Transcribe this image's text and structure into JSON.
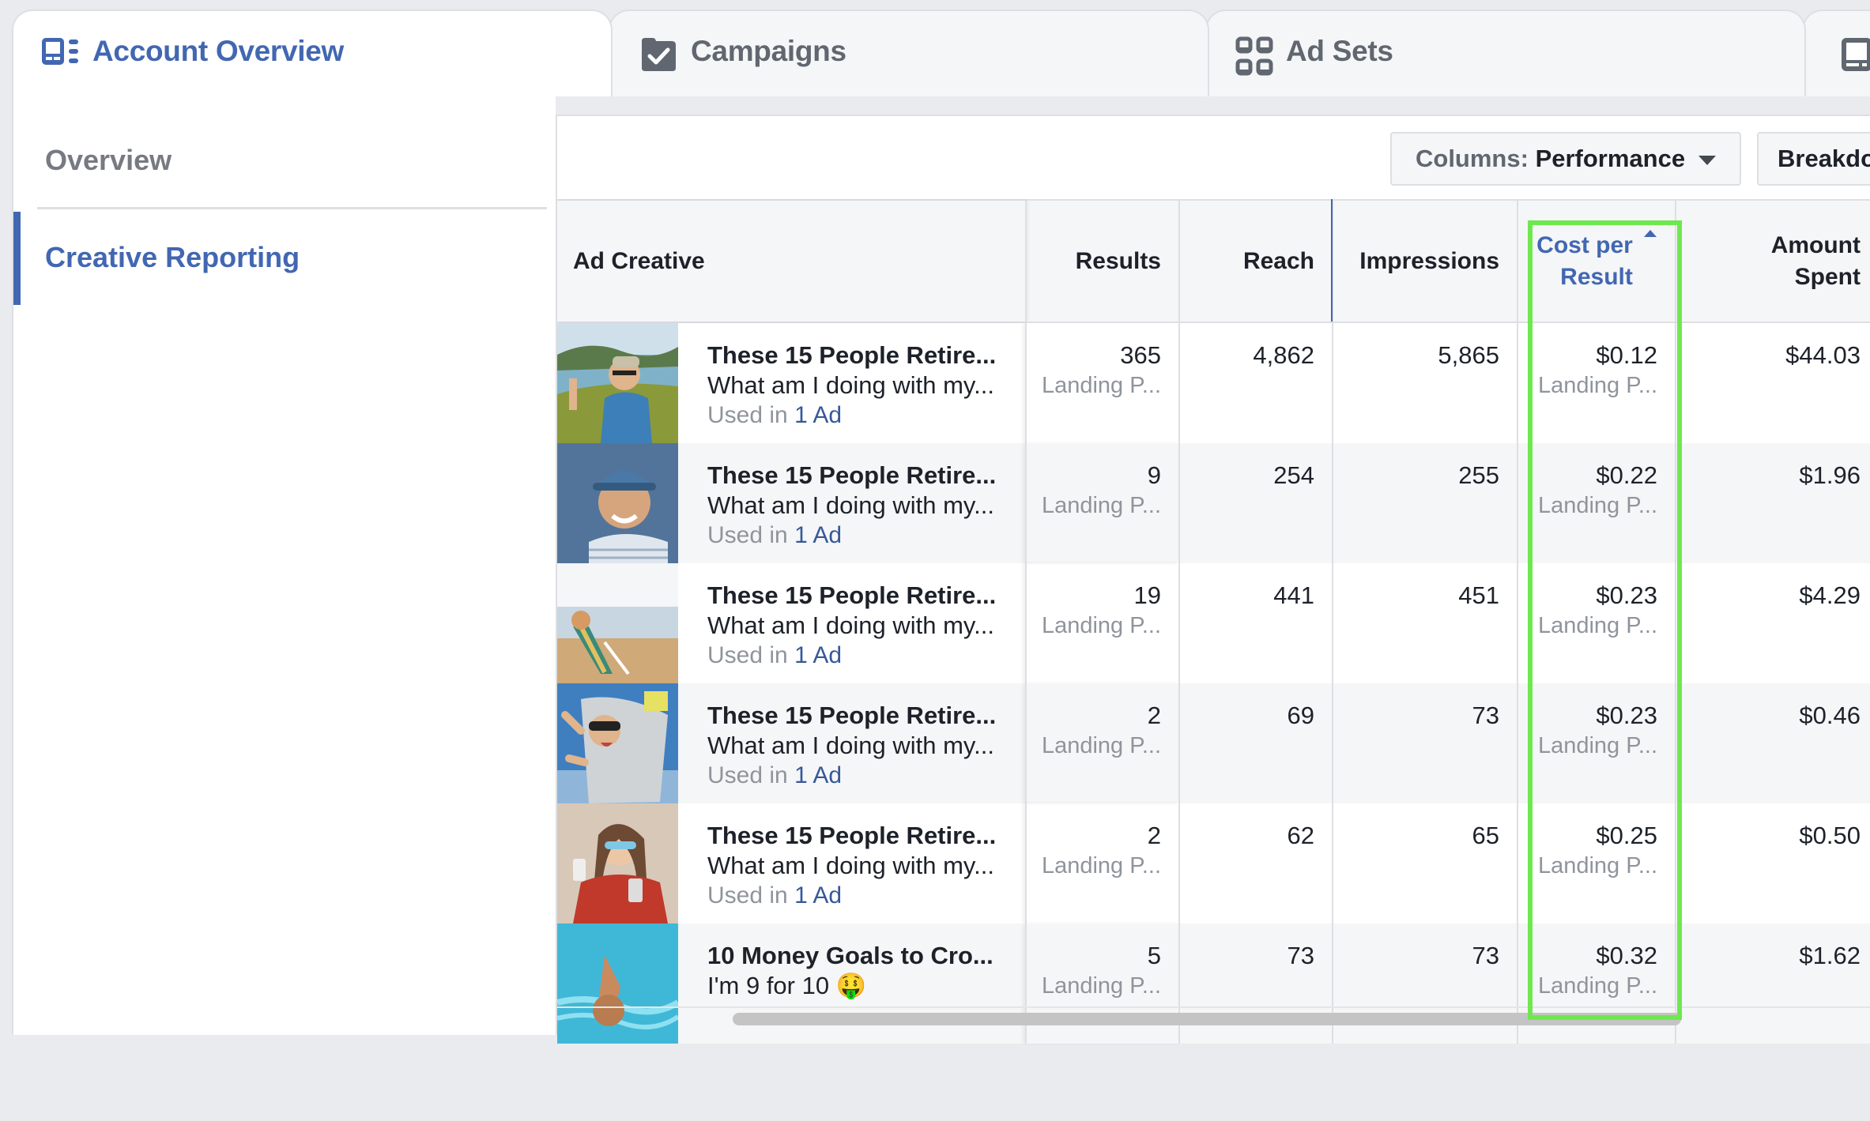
{
  "tabs": [
    {
      "label": "Account Overview",
      "icon": "account-overview-icon",
      "active": true
    },
    {
      "label": "Campaigns",
      "icon": "campaigns-folder-check-icon",
      "active": false
    },
    {
      "label": "Ad Sets",
      "icon": "ad-sets-grid-icon",
      "active": false
    },
    {
      "label": "",
      "icon": "ads-icon",
      "active": false
    }
  ],
  "sidebar": {
    "items": [
      {
        "label": "Overview",
        "active": false
      },
      {
        "label": "Creative Reporting",
        "active": true
      }
    ]
  },
  "toolbar": {
    "columns_prefix": "Columns:",
    "columns_value": "Performance",
    "breakdown_label": "Breakdown"
  },
  "table": {
    "headers": {
      "ad_creative": "Ad Creative",
      "results": "Results",
      "reach": "Reach",
      "impressions": "Impressions",
      "cost_per_result_line1": "Cost per",
      "cost_per_result_line2": "Result",
      "amount_spent_line1": "Amount",
      "amount_spent_line2": "Spent"
    },
    "sorted_column": "Cost per Result",
    "sort_direction": "ascending",
    "rows": [
      {
        "title": "These 15 People Retire...",
        "body": "What am I doing with my...",
        "used_prefix": "Used in",
        "used_link": "1 Ad",
        "results": "365",
        "results_sub": "Landing P...",
        "reach": "4,862",
        "impressions": "5,865",
        "cost": "$0.12",
        "cost_sub": "Landing P...",
        "spent": "$44.03",
        "thumb": "lake-selfie"
      },
      {
        "title": "These 15 People Retire...",
        "body": "What am I doing with my...",
        "used_prefix": "Used in",
        "used_link": "1 Ad",
        "results": "9",
        "results_sub": "Landing P...",
        "reach": "254",
        "impressions": "255",
        "cost": "$0.22",
        "cost_sub": "Landing P...",
        "spent": "$1.96",
        "thumb": "cap-selfie"
      },
      {
        "title": "These 15 People Retire...",
        "body": "What am I doing with my...",
        "used_prefix": "Used in",
        "used_link": "1 Ad",
        "results": "19",
        "results_sub": "Landing P...",
        "reach": "441",
        "impressions": "451",
        "cost": "$0.23",
        "cost_sub": "Landing P...",
        "spent": "$4.29",
        "thumb": "beach-chair"
      },
      {
        "title": "These 15 People Retire...",
        "body": "What am I doing with my...",
        "used_prefix": "Used in",
        "used_link": "1 Ad",
        "results": "2",
        "results_sub": "Landing P...",
        "reach": "69",
        "impressions": "73",
        "cost": "$0.23",
        "cost_sub": "Landing P...",
        "spent": "$0.46",
        "thumb": "skydiver"
      },
      {
        "title": "These 15 People Retire...",
        "body": "What am I doing with my...",
        "used_prefix": "Used in",
        "used_link": "1 Ad",
        "results": "2",
        "results_sub": "Landing P...",
        "reach": "62",
        "impressions": "65",
        "cost": "$0.25",
        "cost_sub": "Landing P...",
        "spent": "$0.50",
        "thumb": "red-jacket-selfie"
      },
      {
        "title": "10 Money Goals to Cro...",
        "body": "I'm 9 for 10 🤑",
        "used_prefix": "",
        "used_link": "",
        "results": "5",
        "results_sub": "Landing P...",
        "reach": "73",
        "impressions": "73",
        "cost": "$0.32",
        "cost_sub": "Landing P...",
        "spent": "$1.62",
        "thumb": "pool-swimmer"
      }
    ]
  },
  "colors": {
    "accent": "#4267b2",
    "link": "#365899",
    "highlight_box": "#6ee84e",
    "muted_text": "#90949c"
  }
}
